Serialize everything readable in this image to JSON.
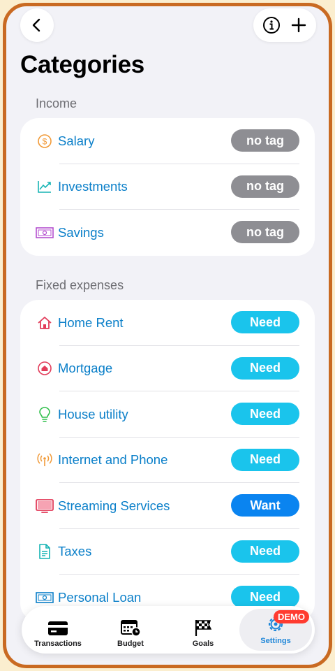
{
  "header": {
    "title": "Categories"
  },
  "sections": [
    {
      "label": "Income",
      "rows": [
        {
          "label": "Salary",
          "tag": "no tag",
          "icon": "dollar-coin-icon"
        },
        {
          "label": "Investments",
          "tag": "no tag",
          "icon": "chart-line-icon"
        },
        {
          "label": "Savings",
          "tag": "no tag",
          "icon": "banknote-icon"
        }
      ]
    },
    {
      "label": "Fixed expenses",
      "rows": [
        {
          "label": "Home Rent",
          "tag": "Need",
          "icon": "house-icon"
        },
        {
          "label": "Mortgage",
          "tag": "Need",
          "icon": "house-circle-icon"
        },
        {
          "label": "House utility",
          "tag": "Need",
          "icon": "lightbulb-icon"
        },
        {
          "label": "Internet and Phone",
          "tag": "Need",
          "icon": "antenna-icon"
        },
        {
          "label": "Streaming Services",
          "tag": "Want",
          "icon": "tv-icon"
        },
        {
          "label": "Taxes",
          "tag": "Need",
          "icon": "document-icon"
        },
        {
          "label": "Personal Loan",
          "tag": "Need",
          "icon": "banknote-icon"
        }
      ]
    }
  ],
  "tabbar": {
    "tabs": [
      {
        "label": "Transactions",
        "icon": "credit-card-icon"
      },
      {
        "label": "Budget",
        "icon": "calendar-clock-icon"
      },
      {
        "label": "Goals",
        "icon": "checkered-flag-icon"
      },
      {
        "label": "Settings",
        "icon": "gear-icon"
      }
    ],
    "badge": "DEMO"
  },
  "colors": {
    "accent": "#0a7fc9",
    "need": "#1ac4ec",
    "want": "#0a84f0",
    "notag": "#8e8e93",
    "frame": "#c96a22",
    "badge": "#ff3b30"
  }
}
